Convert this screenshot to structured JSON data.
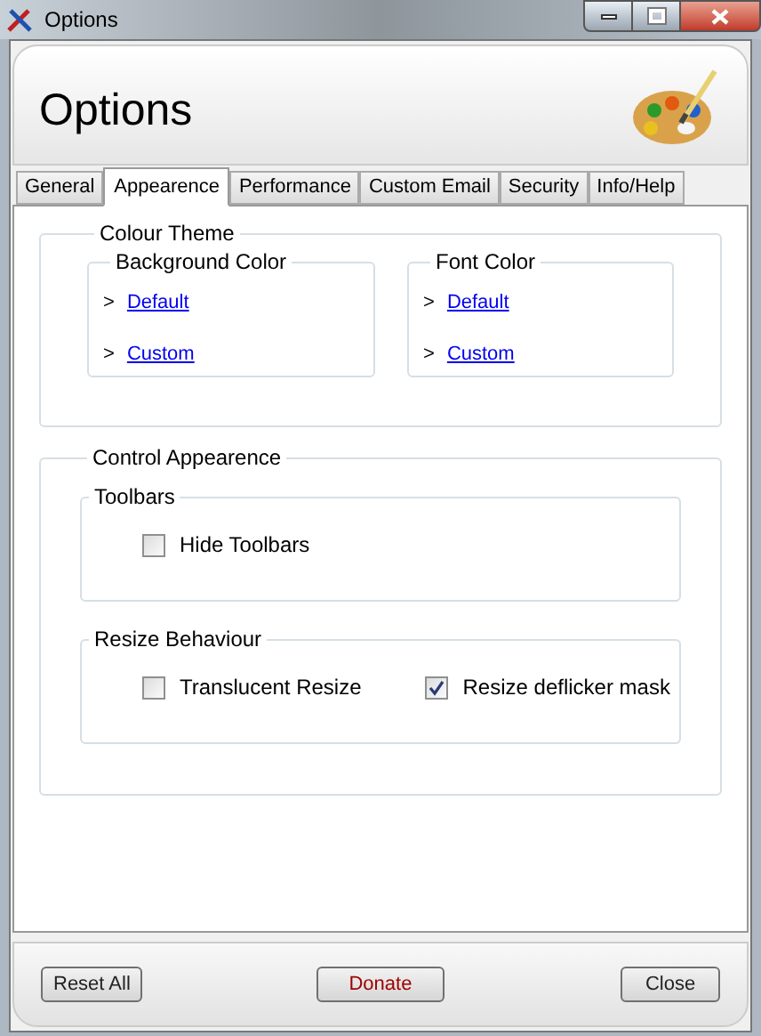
{
  "window": {
    "title": "Options"
  },
  "header": {
    "title": "Options"
  },
  "tabs": [
    {
      "label": "General",
      "selected": false
    },
    {
      "label": "Appearence",
      "selected": true
    },
    {
      "label": "Performance",
      "selected": false
    },
    {
      "label": "Custom Email",
      "selected": false
    },
    {
      "label": "Security",
      "selected": false
    },
    {
      "label": "Info/Help",
      "selected": false
    }
  ],
  "colour_theme": {
    "title": "Colour Theme",
    "groups": [
      {
        "title": "Background Color",
        "links": [
          {
            "marker": ">",
            "label": "Default"
          },
          {
            "marker": ">",
            "label": "Custom"
          }
        ]
      },
      {
        "title": "Font Color",
        "links": [
          {
            "marker": ">",
            "label": "Default"
          },
          {
            "marker": ">",
            "label": "Custom"
          }
        ]
      }
    ]
  },
  "control_appearance": {
    "title": "Control Appearence",
    "groups": [
      {
        "title": "Toolbars",
        "options": [
          {
            "label": "Hide Toolbars",
            "checked": false
          }
        ]
      },
      {
        "title": "Resize Behaviour",
        "options": [
          {
            "label": "Translucent Resize",
            "checked": false
          },
          {
            "label": "Resize deflicker mask",
            "checked": true
          }
        ]
      }
    ]
  },
  "buttons": [
    {
      "label": "Reset All",
      "kind": "normal"
    },
    {
      "label": "Donate",
      "kind": "highlight"
    },
    {
      "label": "Close",
      "kind": "normal"
    }
  ]
}
